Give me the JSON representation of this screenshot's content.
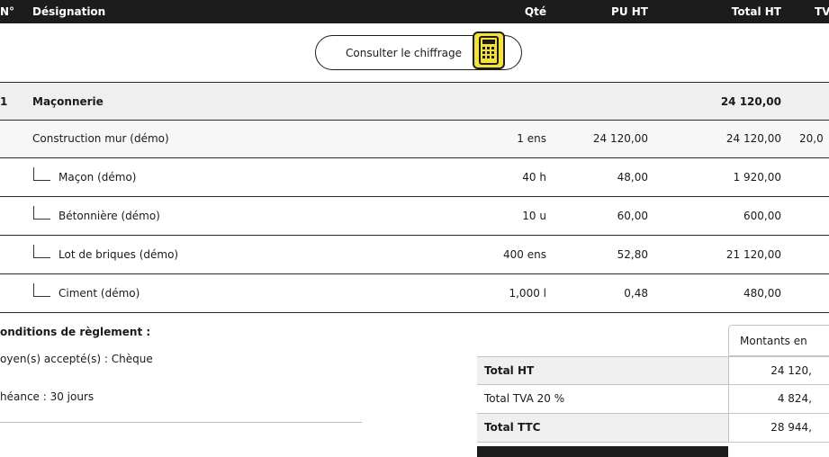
{
  "table": {
    "headers": {
      "no": "N°",
      "designation": "Désignation",
      "qty": "Qté",
      "pu_ht": "PU HT",
      "total_ht": "Total HT",
      "tva": "TV"
    },
    "consult_button": "Consulter le chiffrage",
    "section": {
      "no": "1",
      "label": "Maçonnerie",
      "total": "24 120,00"
    },
    "main_row": {
      "label": "Construction mur (démo)",
      "qty": "1 ens",
      "pu": "24 120,00",
      "total": "24 120,00",
      "tva": "20,0"
    },
    "sub_rows": [
      {
        "label": "Maçon (démo)",
        "qty": "40 h",
        "pu": "48,00",
        "total": "1 920,00"
      },
      {
        "label": "Bétonnière (démo)",
        "qty": "10 u",
        "pu": "60,00",
        "total": "600,00"
      },
      {
        "label": "Lot de briques (démo)",
        "qty": "400 ens",
        "pu": "52,80",
        "total": "21 120,00"
      },
      {
        "label": "Ciment (démo)",
        "qty": "1,000 l",
        "pu": "0,48",
        "total": "480,00"
      }
    ]
  },
  "conditions": {
    "title": "onditions de règlement :",
    "payment": "oyen(s) accepté(s) :  Chèque",
    "due": "héance :  30 jours"
  },
  "totals": {
    "column_header": "Montants en",
    "rows": [
      {
        "label": "Total HT",
        "value": "24 120,"
      },
      {
        "label": "Total TVA 20 %",
        "value": "4 824,"
      },
      {
        "label": "Total TTC",
        "value": "28 944,"
      }
    ]
  }
}
